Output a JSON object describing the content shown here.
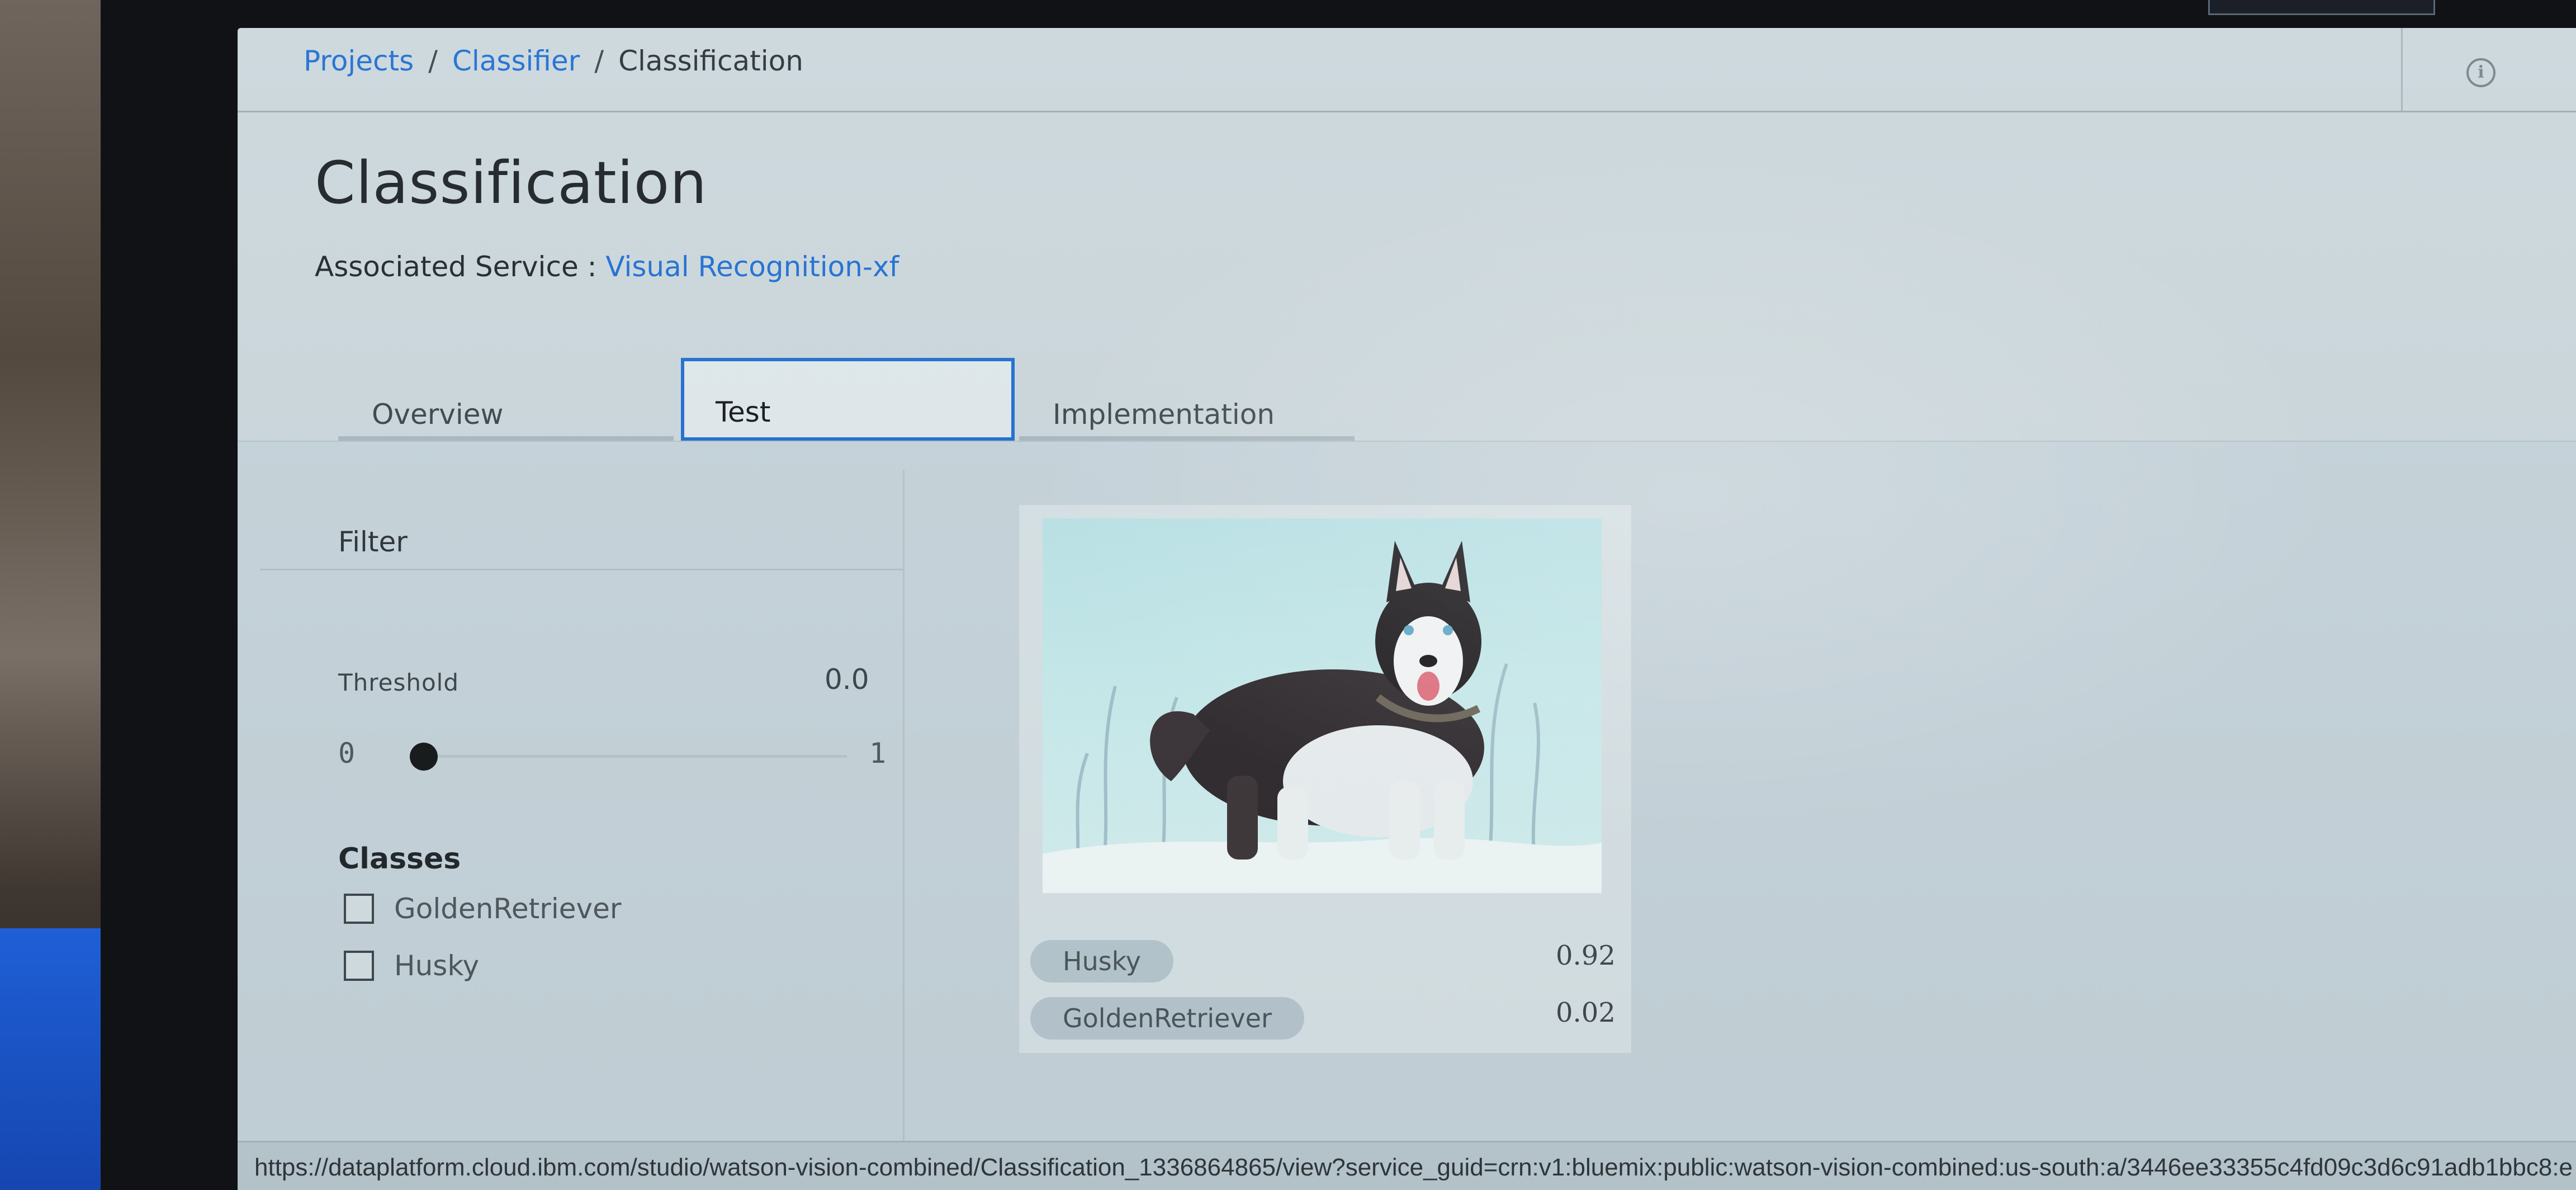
{
  "breadcrumb": {
    "projects": "Projects",
    "separator": "/",
    "classifier": "Classifier",
    "current": "Classification"
  },
  "header": {
    "title": "Classification",
    "associated_service_label": "Associated Service :",
    "associated_service_link": "Visual Recognition-xf",
    "info_icon": "info-icon"
  },
  "tabs": [
    {
      "label": "Overview"
    },
    {
      "label": "Test",
      "active": true
    },
    {
      "label": "Implementation"
    }
  ],
  "filter": {
    "title": "Filter",
    "threshold_label": "Threshold",
    "threshold_value": "0.0",
    "slider_min": "0",
    "slider_max": "1",
    "slider_value": 0.0,
    "classes_label": "Classes",
    "classes": [
      {
        "label": "GoldenRetriever",
        "checked": false
      },
      {
        "label": "Husky",
        "checked": false
      }
    ]
  },
  "result": {
    "predictions": [
      {
        "label": "Husky",
        "score": "0.92"
      },
      {
        "label": "GoldenRetriever",
        "score": "0.02"
      }
    ]
  },
  "status_bar": {
    "url": "https://dataplatform.cloud.ibm.com/studio/watson-vision-combined/Classification_1336864865/view?service_guid=crn:v1:bluemix:public:watson-vision-combined:us-south:a/3446ee33355c4fd09c3d6c91adb1bbc8:e"
  },
  "colors": {
    "link": "#1f6fd1",
    "active_tab_border": "#1f6fd1",
    "screen_bg": "#cbd7dc"
  }
}
